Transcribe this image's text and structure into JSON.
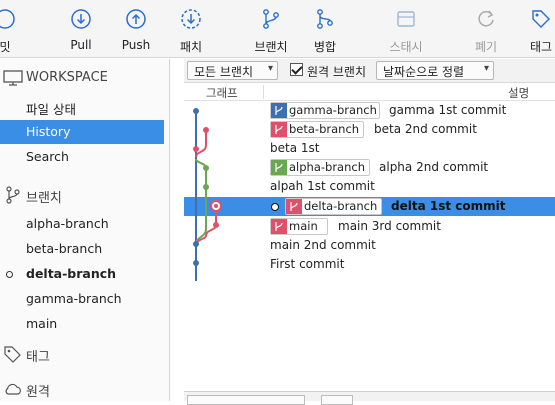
{
  "toolbar": {
    "items": [
      {
        "label": "밋",
        "icon": "commit-icon"
      },
      {
        "label": "Pull",
        "icon": "pull-icon"
      },
      {
        "label": "Push",
        "icon": "push-icon"
      },
      {
        "label": "패치",
        "icon": "fetch-icon"
      },
      {
        "label": "브랜치",
        "icon": "branch-icon"
      },
      {
        "label": "병합",
        "icon": "merge-icon"
      },
      {
        "label": "스태시",
        "icon": "stash-icon",
        "disabled": true
      },
      {
        "label": "폐기",
        "icon": "discard-icon",
        "disabled": true
      },
      {
        "label": "태그",
        "icon": "tag-icon"
      }
    ]
  },
  "sidebar": {
    "workspace": {
      "title": "WORKSPACE",
      "items": [
        {
          "label": "파일 상태"
        },
        {
          "label": "History",
          "selected": true
        },
        {
          "label": "Search"
        }
      ]
    },
    "branches": {
      "title": "브랜치",
      "items": [
        {
          "label": "alpha-branch"
        },
        {
          "label": "beta-branch"
        },
        {
          "label": "delta-branch",
          "current": true
        },
        {
          "label": "gamma-branch"
        },
        {
          "label": "main"
        }
      ]
    },
    "tags_title": "태그",
    "remotes_title": "원격"
  },
  "filter": {
    "branches_dropdown": "모든 브랜치",
    "remote_checkbox_label": "원격 브랜치",
    "remote_checked": true,
    "sort_dropdown": "날짜순으로 정렬"
  },
  "columns": {
    "graph": "그래프",
    "description": "설명"
  },
  "commits": [
    {
      "branch": "gamma-branch",
      "message": "gamma 1st commit",
      "color": "#3d6fb4"
    },
    {
      "branch": "beta-branch",
      "message": "beta 2nd commit",
      "color": "#e0506a"
    },
    {
      "branch": "",
      "message": "beta 1st",
      "color": "#e0506a"
    },
    {
      "branch": "alpha-branch",
      "message": "alpha 2nd commit",
      "color": "#6aa84f"
    },
    {
      "branch": "",
      "message": "alpah 1st commit",
      "color": "#6aa84f"
    },
    {
      "branch": "delta-branch",
      "message": "delta 1st commit",
      "color": "#e0506a",
      "selected": true,
      "head": true
    },
    {
      "branch": "main",
      "message": "main 3rd commit",
      "color": "#e0506a"
    },
    {
      "branch": "",
      "message": "main 2nd commit",
      "color": "#3d6fb4"
    },
    {
      "branch": "",
      "message": "First commit",
      "color": "#3d6fb4"
    }
  ],
  "colors": {
    "accent": "#3a8ee6",
    "blue_lane": "#3d6fb4",
    "red_lane": "#e0506a",
    "green_lane": "#6aa84f"
  }
}
